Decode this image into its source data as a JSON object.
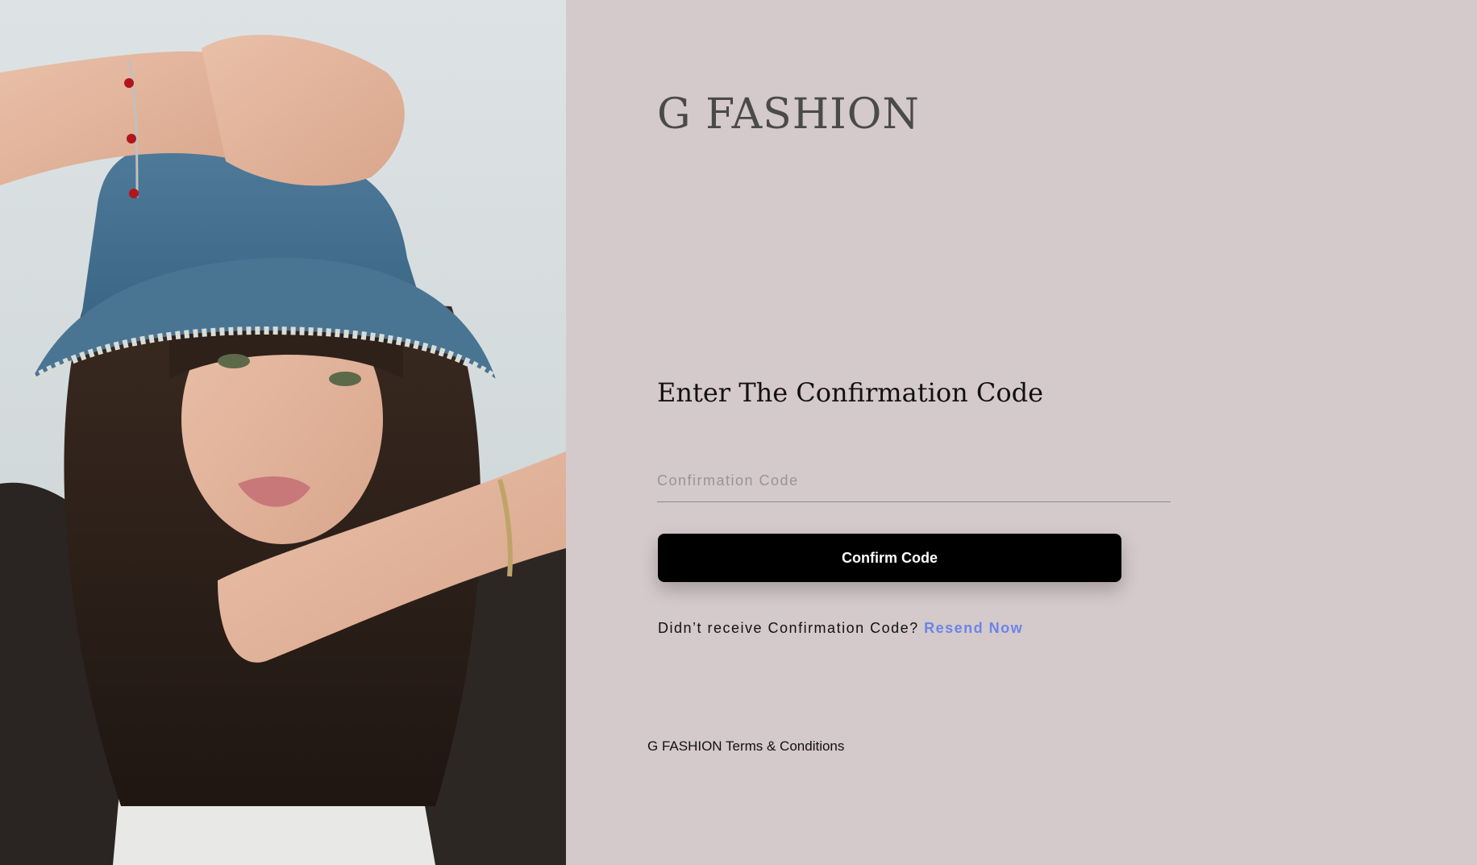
{
  "brand": {
    "title": "G FASHION"
  },
  "hero_image": {
    "description_icon": "model-photo"
  },
  "form": {
    "heading": "Enter The Confirmation Code",
    "code_field": {
      "placeholder": "Confirmation Code",
      "value": ""
    },
    "confirm_button_label": "Confirm Code",
    "resend_prompt": "Didn’t receive Confirmation Code?",
    "resend_link_label": "Resend Now"
  },
  "footer": {
    "terms_label": "G FASHION Terms & Conditions"
  },
  "colors": {
    "background": "#d4c9cb",
    "button": "#000000",
    "link_accent": "#6b84e8",
    "brand_text": "#4a4a4a"
  }
}
